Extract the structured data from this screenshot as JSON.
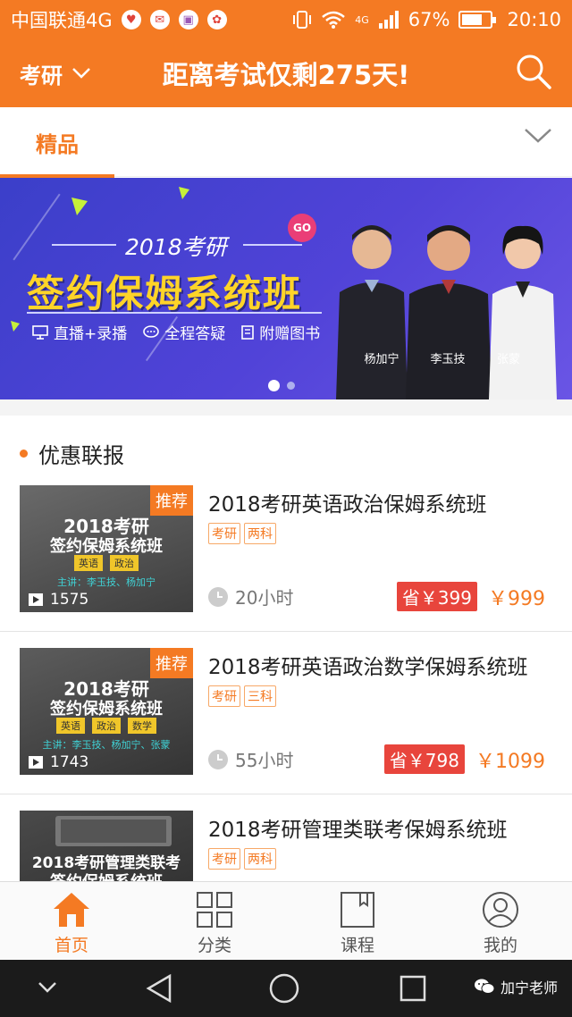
{
  "status_bar": {
    "carrier": "中国联通4G",
    "network": "4G",
    "battery": "67%",
    "time": "20:10"
  },
  "header": {
    "exam_selector": "考研",
    "countdown": "距离考试仅剩275天!"
  },
  "tabs": {
    "active": "精品"
  },
  "banner": {
    "year_label": "2018考研",
    "main_title": "签约保姆系统班",
    "go_badge": "GO",
    "features": [
      "直播+录播",
      "全程答疑",
      "附赠图书"
    ],
    "teachers": [
      "杨加宁",
      "李玉技",
      "张蒙"
    ]
  },
  "section": {
    "title": "优惠联报"
  },
  "courses": [
    {
      "badge": "推荐",
      "thumb_line1": "2018考研",
      "thumb_line2": "签约保姆系统班",
      "thumb_tags": [
        "英语",
        "政治"
      ],
      "thumb_teachers": "主讲：李玉技、杨加宁",
      "views": "1575",
      "title": "2018考研英语政治保姆系统班",
      "tags": [
        "考研",
        "两科"
      ],
      "duration": "20小时",
      "save": "省￥399",
      "price": "￥999"
    },
    {
      "badge": "推荐",
      "thumb_line1": "2018考研",
      "thumb_line2": "签约保姆系统班",
      "thumb_tags": [
        "英语",
        "政治",
        "数学"
      ],
      "thumb_teachers": "主讲：李玉技、杨加宁、张蒙",
      "views": "1743",
      "title": "2018考研英语政治数学保姆系统班",
      "tags": [
        "考研",
        "三科"
      ],
      "duration": "55小时",
      "save": "省￥798",
      "price": "￥1099"
    },
    {
      "thumb_line1": "2018考研管理类联考",
      "thumb_line2": "签约保姆系统班",
      "title": "2018考研管理类联考保姆系统班",
      "tags": [
        "考研",
        "两科"
      ]
    }
  ],
  "bottom_nav": [
    {
      "label": "首页",
      "icon": "home-icon",
      "active": true
    },
    {
      "label": "分类",
      "icon": "grid-icon",
      "active": false
    },
    {
      "label": "课程",
      "icon": "book-icon",
      "active": false
    },
    {
      "label": "我的",
      "icon": "profile-icon",
      "active": false
    }
  ],
  "system_nav": {
    "watermark": "加宁老师"
  },
  "colors": {
    "brand": "#f47a23",
    "save_red": "#e8453c",
    "banner_blue": "#4a41d4",
    "banner_yellow": "#ffd428"
  }
}
